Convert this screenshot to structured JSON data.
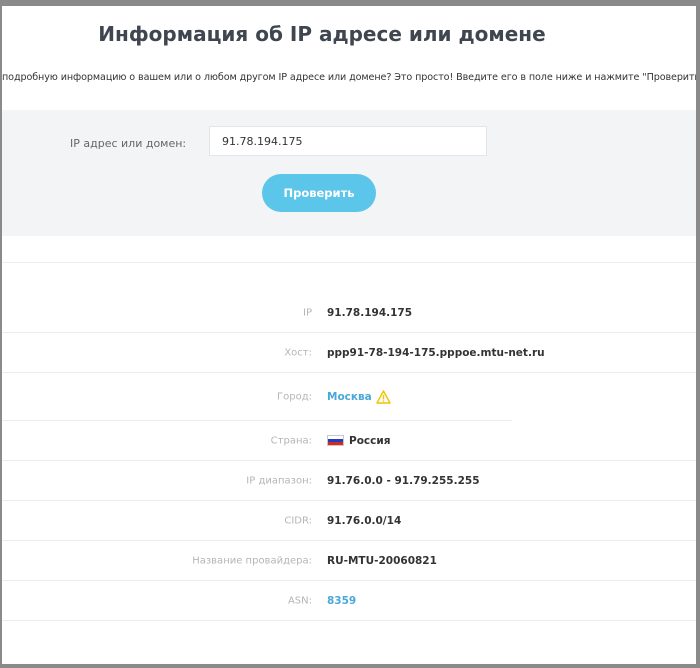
{
  "page": {
    "title": "Информация об IP адресе или домене",
    "subtitle": "подробную информацию о вашем или о любом другом IP адресе или домене? Это просто! Введите его в поле ниже и нажмите \"Проверить\"."
  },
  "form": {
    "label": "IP адрес или домен:",
    "input_value": "91.78.194.175",
    "button_label": "Проверить"
  },
  "info": {
    "ip": {
      "label": "IP",
      "value": "91.78.194.175"
    },
    "host": {
      "label": "Хост:",
      "value": "ppp91-78-194-175.pppoe.mtu-net.ru"
    },
    "city": {
      "label": "Город:",
      "value": "Москва",
      "icon": "warning-icon"
    },
    "country": {
      "label": "Страна:",
      "value": "Россия",
      "icon": "russia-flag-icon"
    },
    "range": {
      "label": "IP диапазон:",
      "value": "91.76.0.0 - 91.79.255.255"
    },
    "cidr": {
      "label": "CIDR:",
      "value": "91.76.0.0/14"
    },
    "provider": {
      "label": "Название провайдера:",
      "value": "RU-MTU-20060821"
    },
    "asn": {
      "label": "ASN:",
      "value": "8359"
    }
  },
  "colors": {
    "accent": "#5bc5ea",
    "link": "#4aa8d8",
    "warning": "#f2c200",
    "flag_white": "#ffffff",
    "flag_blue": "#1f3fbf",
    "flag_red": "#d52b1e"
  }
}
